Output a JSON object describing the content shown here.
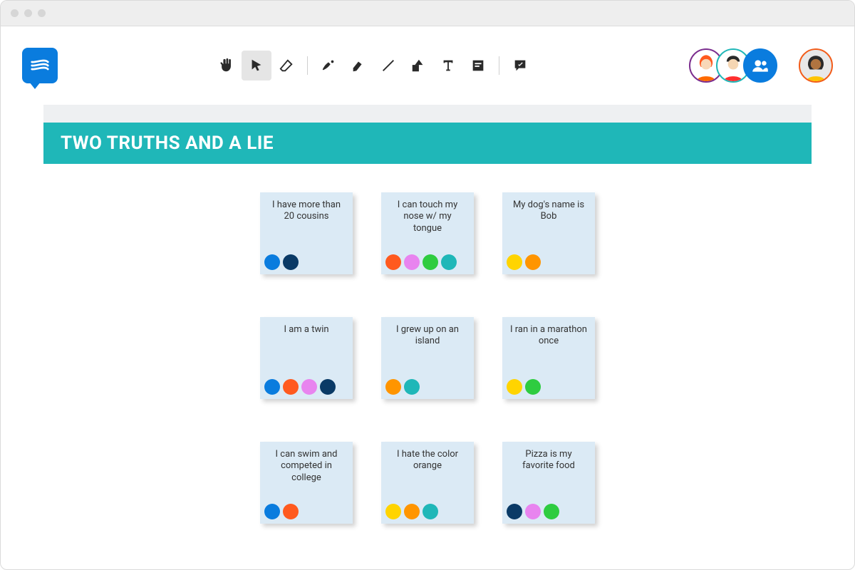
{
  "banner": {
    "title": "TWO TRUTHS AND A LIE"
  },
  "toolbar": {
    "tools": [
      {
        "id": "hand",
        "name": "hand-tool"
      },
      {
        "id": "select",
        "name": "select-tool",
        "active": true
      },
      {
        "id": "eraser",
        "name": "eraser-tool"
      },
      {
        "id": "pen",
        "name": "pen-tool"
      },
      {
        "id": "highlighter",
        "name": "highlighter-tool"
      },
      {
        "id": "line",
        "name": "line-tool"
      },
      {
        "id": "shape",
        "name": "shape-tool"
      },
      {
        "id": "text",
        "name": "text-tool"
      },
      {
        "id": "note",
        "name": "sticky-note-tool"
      },
      {
        "id": "comment",
        "name": "comment-tool"
      }
    ]
  },
  "collaborators": [
    {
      "border": "#7b2d8e",
      "hair": "#ff5a1f",
      "skin": "#f8d8b8",
      "shirt": "#ff6a00"
    },
    {
      "border": "#1fb7b8",
      "hair": "#2a2a2a",
      "skin": "#f5d6b3",
      "shirt": "#ff2e2e"
    },
    {
      "border": "#0a7cde",
      "bg": "#0a7cde",
      "icon": true
    }
  ],
  "self_avatar": {
    "border": "#f25c1a",
    "hair": "#2a2a2a",
    "skin": "#b07440",
    "shirt": "#ffc400"
  },
  "cards": [
    {
      "text": "I have more than 20 cousins",
      "votes": [
        "#0a7cde",
        "#0a3a66"
      ]
    },
    {
      "text": "I can touch my nose w/ my tongue",
      "votes": [
        "#ff5a1f",
        "#e884ef",
        "#2ecc40",
        "#1fb7b8"
      ]
    },
    {
      "text": "My dog's name is Bob",
      "votes": [
        "#ffd400",
        "#ff9500"
      ]
    },
    {
      "text": "I am a twin",
      "votes": [
        "#0a7cde",
        "#ff5a1f",
        "#e884ef",
        "#0a3a66"
      ]
    },
    {
      "text": "I grew up on an island",
      "votes": [
        "#ff9500",
        "#1fb7b8"
      ]
    },
    {
      "text": "I ran in a marathon once",
      "votes": [
        "#ffd400",
        "#2ecc40"
      ]
    },
    {
      "text": "I can swim and competed in college",
      "votes": [
        "#0a7cde",
        "#ff5a1f"
      ]
    },
    {
      "text": "I hate the color orange",
      "votes": [
        "#ffd400",
        "#ff9500",
        "#1fb7b8"
      ]
    },
    {
      "text": "Pizza is my favorite food",
      "votes": [
        "#0a3a66",
        "#e884ef",
        "#2ecc40"
      ]
    }
  ],
  "vote_colors": {
    "blue": "#0a7cde",
    "navy": "#0a3a66",
    "orange": "#ff5a1f",
    "pink": "#e884ef",
    "green": "#2ecc40",
    "teal": "#1fb7b8",
    "yellow": "#ffd400",
    "darkorange": "#ff9500"
  }
}
